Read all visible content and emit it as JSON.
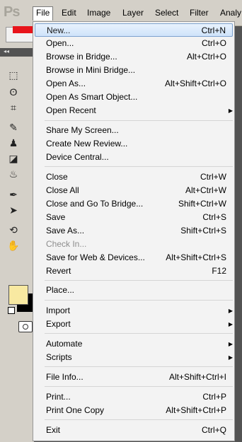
{
  "app": {
    "logo": "Ps"
  },
  "menubar": {
    "items": [
      "File",
      "Edit",
      "Image",
      "Layer",
      "Select",
      "Filter",
      "Analy"
    ]
  },
  "file_menu": {
    "items": [
      {
        "label": "New...",
        "shortcut": "Ctrl+N",
        "highlighted": true
      },
      {
        "label": "Open...",
        "shortcut": "Ctrl+O"
      },
      {
        "label": "Browse in Bridge...",
        "shortcut": "Alt+Ctrl+O"
      },
      {
        "label": "Browse in Mini Bridge...",
        "shortcut": ""
      },
      {
        "label": "Open As...",
        "shortcut": "Alt+Shift+Ctrl+O"
      },
      {
        "label": "Open As Smart Object...",
        "shortcut": ""
      },
      {
        "label": "Open Recent",
        "shortcut": "",
        "submenu": true
      },
      {
        "label": "Share My Screen...",
        "shortcut": ""
      },
      {
        "label": "Create New Review...",
        "shortcut": ""
      },
      {
        "label": "Device Central...",
        "shortcut": ""
      },
      {
        "label": "Close",
        "shortcut": "Ctrl+W"
      },
      {
        "label": "Close All",
        "shortcut": "Alt+Ctrl+W"
      },
      {
        "label": "Close and Go To Bridge...",
        "shortcut": "Shift+Ctrl+W"
      },
      {
        "label": "Save",
        "shortcut": "Ctrl+S"
      },
      {
        "label": "Save As...",
        "shortcut": "Shift+Ctrl+S"
      },
      {
        "label": "Check In...",
        "shortcut": "",
        "disabled": true
      },
      {
        "label": "Save for Web & Devices...",
        "shortcut": "Alt+Shift+Ctrl+S"
      },
      {
        "label": "Revert",
        "shortcut": "F12"
      },
      {
        "label": "Place...",
        "shortcut": ""
      },
      {
        "label": "Import",
        "shortcut": "",
        "submenu": true
      },
      {
        "label": "Export",
        "shortcut": "",
        "submenu": true
      },
      {
        "label": "Automate",
        "shortcut": "",
        "submenu": true
      },
      {
        "label": "Scripts",
        "shortcut": "",
        "submenu": true
      },
      {
        "label": "File Info...",
        "shortcut": "Alt+Shift+Ctrl+I"
      },
      {
        "label": "Print...",
        "shortcut": "Ctrl+P"
      },
      {
        "label": "Print One Copy",
        "shortcut": "Alt+Shift+Ctrl+P"
      },
      {
        "label": "Exit",
        "shortcut": "Ctrl+Q"
      }
    ]
  },
  "colors": {
    "foreground": "#f8e9a1",
    "background": "#000000",
    "highlight": "#cfe3fa",
    "arrow": "#e8141a"
  },
  "icons": {
    "submenu": "triangle-right-icon",
    "pointer": "red-arrow-icon"
  }
}
